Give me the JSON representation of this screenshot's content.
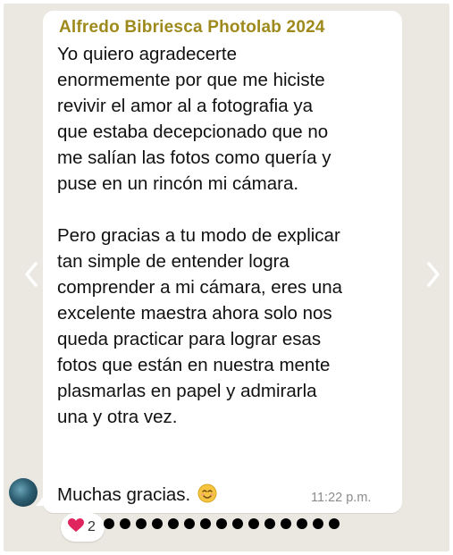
{
  "message": {
    "sender": "Alfredo Bibriesca Photolab 2024",
    "paragraph1": [
      "Yo quiero agradecerte",
      "enormemente por que me hiciste",
      "revivir el amor al a fotografia ya",
      "que estaba decepcionado que no",
      "me salían las fotos como quería y",
      "puse en un rincón mi cámara."
    ],
    "paragraph2": [
      "Pero gracias a tu modo de explicar",
      "tan simple de entender logra",
      "comprender a mi cámara, eres una",
      "excelente maestra ahora solo nos",
      "queda practicar para lograr esas",
      "fotos que están en nuestra mente",
      "plasmarlas en papel y admirarla",
      "una y otra vez."
    ],
    "closing": "Muchas gracias.",
    "closing_emoji": "☺",
    "time": "11:22 p.m."
  },
  "reaction": {
    "emoji": "heart-icon",
    "count": "2"
  },
  "carousel": {
    "dot_count": 15,
    "prev_icon": "chevron-left-icon",
    "next_icon": "chevron-right-icon"
  },
  "colors": {
    "background": "#ebe7e1",
    "bubble": "#ffffff",
    "sender": "#9e8a1c",
    "heart": "#e0245e"
  }
}
